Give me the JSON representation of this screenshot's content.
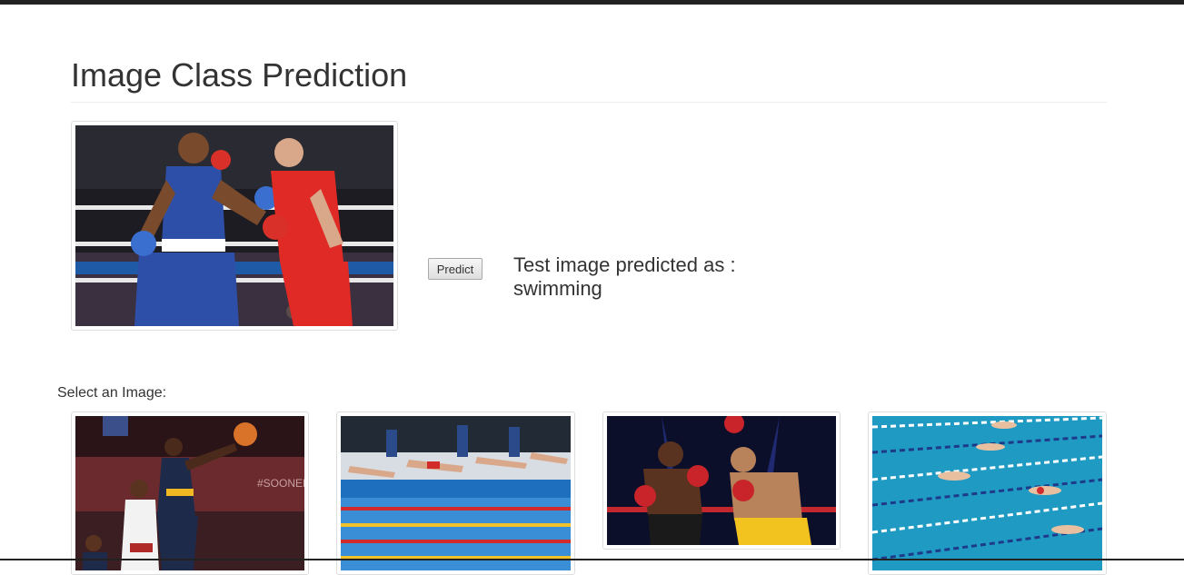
{
  "page": {
    "title": "Image Class Prediction"
  },
  "predict": {
    "button_label": "Predict",
    "result_prefix": "Test image predicted as :",
    "result_value": "swimming"
  },
  "gallery": {
    "label": "Select an Image:",
    "images": [
      {
        "subject": "basketball"
      },
      {
        "subject": "swimming"
      },
      {
        "subject": "boxing"
      },
      {
        "subject": "swimming"
      }
    ]
  },
  "selected_image": {
    "subject": "boxing"
  }
}
